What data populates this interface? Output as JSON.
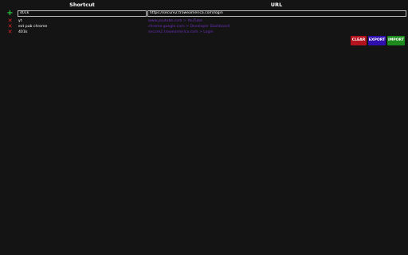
{
  "header": {
    "shortcut_label": "Shortcut",
    "url_label": "URL"
  },
  "input": {
    "add_icon": "plus-icon",
    "shortcut_value": "401k",
    "url_value": "https://secure2.troweamerica.com/login"
  },
  "rows": [
    {
      "shortcut": "yt",
      "url": "www.youtube.com > YouTube",
      "delete_icon": "x-icon"
    },
    {
      "shortcut": "ext pub chrome",
      "url": "chrome.google.com > Developer Dashboard",
      "delete_icon": "x-icon"
    },
    {
      "shortcut": "401k",
      "url": "secure2.troweamerica.com > Login",
      "delete_icon": "x-icon"
    }
  ],
  "buttons": {
    "clear": "CLEAR",
    "export": "EXPORT",
    "import": "IMPORT"
  },
  "colors": {
    "background": "#141414",
    "add": "#2ecc40",
    "delete": "#e0242a",
    "link": "#6b2fb8",
    "clear": "#b3121f",
    "export": "#2f0fae",
    "import": "#1c8a1c"
  }
}
